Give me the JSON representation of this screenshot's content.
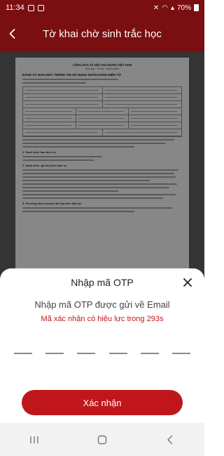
{
  "status_bar": {
    "time": "11:34",
    "battery": "70%"
  },
  "app_bar": {
    "title": "Tờ khai chờ sinh trắc học"
  },
  "document": {
    "header_line1": "CỘNG HÒA XÃ HỘI CHỦ NGHĨA VIỆT NAM",
    "header_line2": "Độc lập - Tự do - Hạnh phúc",
    "form_title": "ĐĂNG KÝ HẠN MỨC THÔNG TIN SỬ DỤNG NGÂN HÀNG ĐIỆN TỬ",
    "section1": "1. Danh thức ban dịch vụ",
    "section2": "2. Danh thức, gói thị tiếm dịch vụ",
    "section3": "3. Phương thức chuyển đổi hóa đơn điện tử"
  },
  "otp_sheet": {
    "title": "Nhập mã OTP",
    "instruction": "Nhập mã OTP được gửi về Email",
    "validity": "Mã xác nhận có hiệu lực trong 293s",
    "slot_count": 6,
    "confirm_label": "Xác nhận"
  },
  "colors": {
    "header": "#7a0f12",
    "accent": "#c0161b"
  },
  "icons": {
    "back": "arrow-left-icon",
    "close": "close-icon",
    "nav_recents": "recents-icon",
    "nav_home": "home-icon",
    "nav_back": "back-icon"
  }
}
